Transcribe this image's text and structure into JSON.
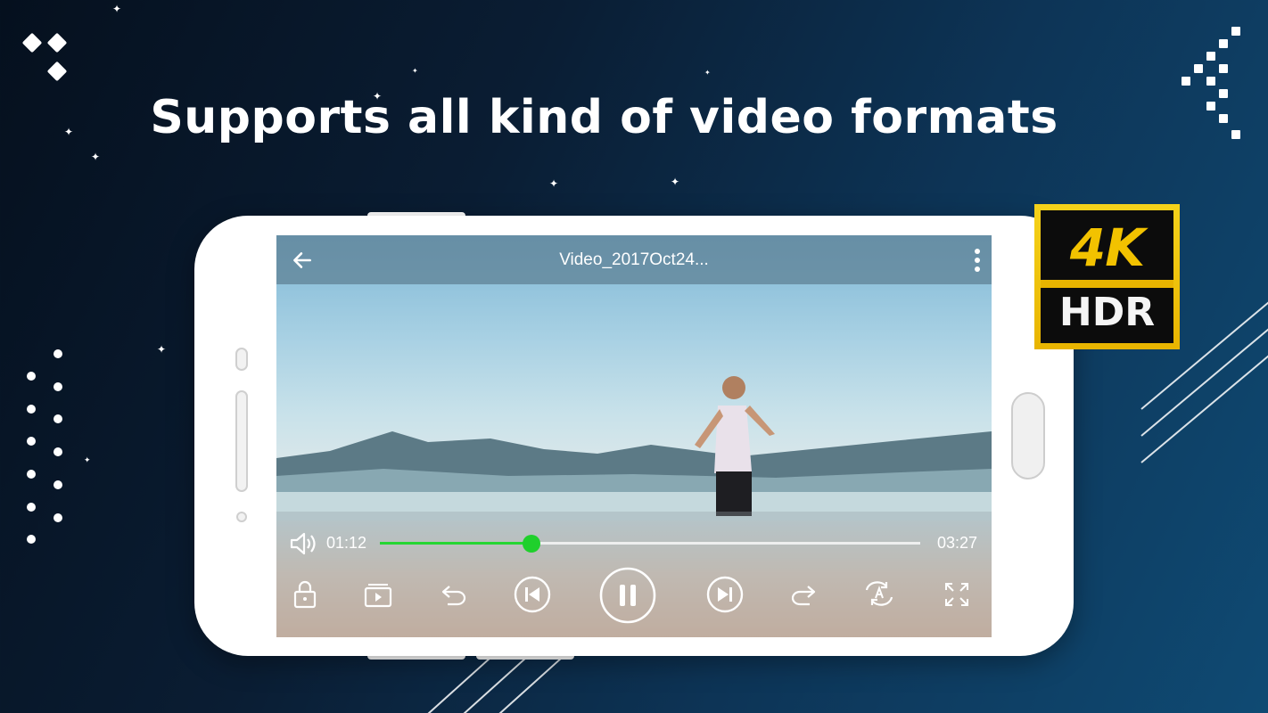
{
  "headline": "Supports all kind of video formats",
  "player": {
    "title": "Video_2017Oct24...",
    "time_current": "01:12",
    "time_total": "03:27",
    "progress_fraction": 0.28,
    "seek_color": "#25d633"
  },
  "controls": [
    "lock-icon",
    "playlist-icon",
    "rewind-icon",
    "previous-icon",
    "pause-icon",
    "next-icon",
    "forward-icon",
    "repeat-ab-icon",
    "fullscreen-icon"
  ],
  "badge": {
    "line1": "4K",
    "line2": "HDR",
    "gold": "#f2c200"
  }
}
